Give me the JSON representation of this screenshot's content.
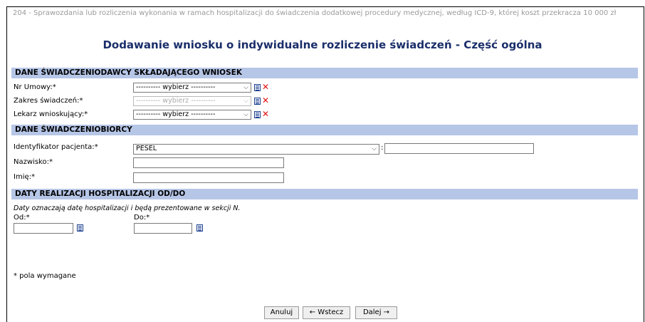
{
  "header": {
    "top_note": "204 - Sprawozdania lub rozliczenia wykonania w ramach hospitalizacji do świadczenia dodatkowej procedury medycznej, według ICD-9, której koszt przekracza 10 000 zł",
    "title": "Dodawanie wniosku o indywidualne rozliczenie świadczeń - Część ogólna"
  },
  "section1": {
    "title": "DANE ŚWIADCZENIODAWCY SKŁADAJĄCEGO WNIOSEK",
    "nr_umowy_label": "Nr Umowy:*",
    "nr_umowy_value": "---------- wybierz ----------",
    "zakres_label": "Zakres świadczeń:*",
    "zakres_value": "---------- wybierz ----------",
    "lekarz_label": "Lekarz wnioskujący:*",
    "lekarz_value": "---------- wybierz ----------"
  },
  "section2": {
    "title": "DANE ŚWIADCZENIOBIORCY",
    "identyfikator_label": "Identyfikator pacjenta:*",
    "identyfikator_value": "PESEL",
    "colon": ":",
    "nazwisko_label": "Nazwisko:*",
    "imie_label": "Imię:*"
  },
  "section3": {
    "title": "DATY REALIZACJI HOSPITALIZACJI OD/DO",
    "note": "Daty oznaczają datę hospitalizacji i będą prezentowane w sekcji N.",
    "od_label": "Od:*",
    "do_label": "Do:*"
  },
  "footer": {
    "required_note": "* pola wymagane",
    "cancel_label": "Anuluj",
    "back_label": "← Wstecz",
    "next_label": "Dalej →"
  },
  "colors": {
    "section_bg": "#b6c6e7",
    "title_color": "#1a2e6a",
    "delete_icon": "#e01010"
  }
}
